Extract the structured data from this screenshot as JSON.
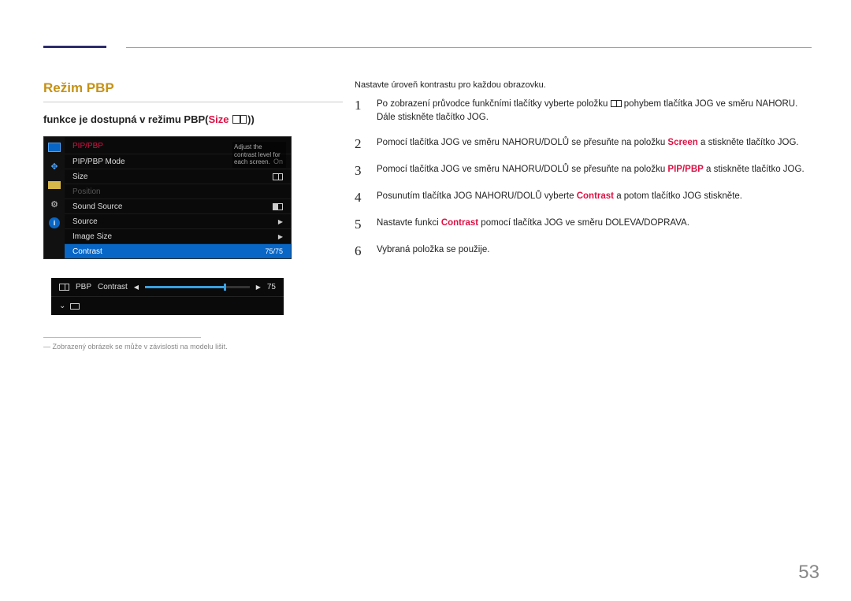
{
  "page_number": "53",
  "heading": "Režim PBP",
  "subheading_prefix": "funkce je dostupná v režimu PBP(",
  "subheading_size": "Size",
  "subheading_suffix": "))",
  "osd": {
    "title": "PIP/PBP",
    "tooltip": "Adjust the contrast level for each screen.",
    "rows": [
      {
        "label": "PIP/PBP Mode",
        "value": "On"
      },
      {
        "label": "Size",
        "value_icon": "pbp"
      },
      {
        "label": "Position",
        "disabled": true
      },
      {
        "label": "Sound Source",
        "value_icon": "pbp-filled"
      },
      {
        "label": "Source",
        "value_icon": "tri"
      },
      {
        "label": "Image Size",
        "value_icon": "tri"
      },
      {
        "label": "Contrast",
        "value": "75/75",
        "selected": true
      }
    ]
  },
  "slider": {
    "label_prefix": "PBP",
    "label": "Contrast",
    "value": "75"
  },
  "footnote": "Zobrazený obrázek se může v závislosti na modelu lišit.",
  "intro": "Nastavte úroveň kontrastu pro každou obrazovku.",
  "steps": [
    {
      "num": "1",
      "parts": [
        {
          "t": "Po zobrazení průvodce funkčními tlačítky vyberte položku "
        },
        {
          "icon": true
        },
        {
          "t": " pohybem tlačítka JOG ve směru NAHORU. Dále stiskněte tlačítko JOG."
        }
      ]
    },
    {
      "num": "2",
      "parts": [
        {
          "t": "Pomocí tlačítka JOG ve směru NAHORU/DOLŮ se přesuňte na položku "
        },
        {
          "hl": "Screen"
        },
        {
          "t": " a stiskněte tlačítko JOG."
        }
      ]
    },
    {
      "num": "3",
      "parts": [
        {
          "t": "Pomocí tlačítka JOG ve směru NAHORU/DOLŮ se přesuňte na položku "
        },
        {
          "hl": "PIP/PBP"
        },
        {
          "t": " a stiskněte tlačítko JOG."
        }
      ]
    },
    {
      "num": "4",
      "parts": [
        {
          "t": "Posunutím tlačítka JOG NAHORU/DOLŮ vyberte "
        },
        {
          "hl": "Contrast"
        },
        {
          "t": " a potom tlačítko JOG stiskněte."
        }
      ]
    },
    {
      "num": "5",
      "parts": [
        {
          "t": "Nastavte funkci "
        },
        {
          "hl": "Contrast"
        },
        {
          "t": " pomocí tlačítka JOG ve směru DOLEVA/DOPRAVA."
        }
      ]
    },
    {
      "num": "6",
      "parts": [
        {
          "t": "Vybraná položka se použije."
        }
      ]
    }
  ]
}
